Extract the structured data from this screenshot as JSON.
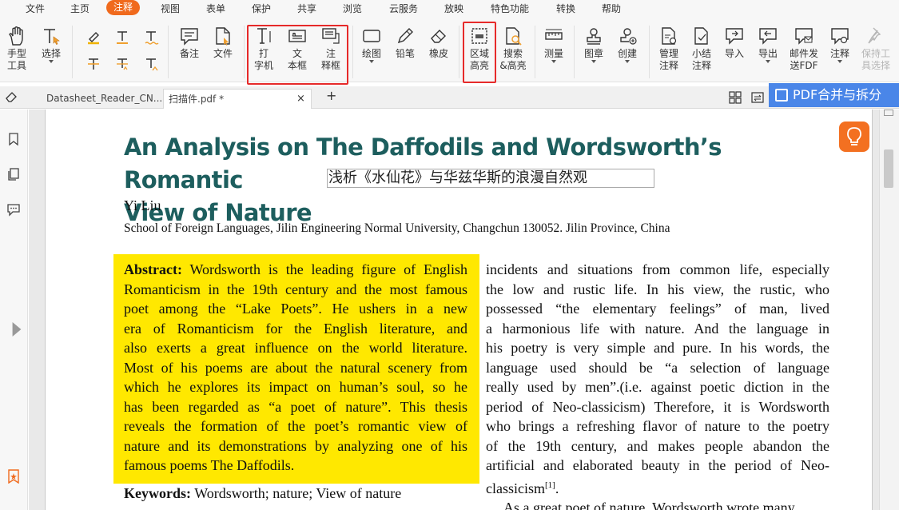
{
  "menu": {
    "items": [
      "文件",
      "主页",
      "注释",
      "视图",
      "表单",
      "保护",
      "共享",
      "浏览",
      "云服务",
      "放映",
      "特色功能",
      "转换",
      "帮助"
    ],
    "active": "注释"
  },
  "toolbar": {
    "hand": "手型\n工具",
    "select": "选择",
    "note": "备注",
    "file": "文件",
    "typewriter": "打\n字机",
    "textbox": "文\n本框",
    "callout": "注\n释框",
    "drawing": "绘图",
    "pencil": "铅笔",
    "eraser": "橡皮",
    "area_highlight": "区域\n高亮",
    "search_highlight": "搜索\n&高亮",
    "measure": "测量",
    "stamp": "图章",
    "create": "创建",
    "manage": "管理\n注释",
    "summary": "小结\n注释",
    "import": "导入",
    "export": "导出",
    "email": "邮件发\n送FDF",
    "annotate": "注释",
    "keep_tool": "保持工\n具选择"
  },
  "tabs": {
    "tab1": "Datasheet_Reader_CN....",
    "tab2": "扫描件.pdf *",
    "close": "×",
    "add": "+"
  },
  "promo": "PDF合并与拆分",
  "document": {
    "title_line1": "An Analysis on The Daffodils and Wordsworth’s Romantic",
    "title_line2": "View of Nature",
    "chinese_title": "浅析《水仙花》与华兹华斯的浪漫自然观",
    "author": "Yi Liu",
    "affiliation": "School of Foreign Languages, Jilin Engineering Normal University, Changchun 130052. Jilin Province, China",
    "abstract_label": "Abstract:",
    "abstract_lines": [
      "Wordsworth is the leading figure of English",
      "Romanticism in the 19th century and the most famous",
      "poet among the “Lake Poets”. He ushers in a new",
      "era of Romanticism for the English literature, and",
      "also exerts a great influence on the world literature.",
      "Most of his poems are about the natural scenery from",
      "which he explores its impact on human’s soul, so he",
      "has been regarded as “a poet of nature”. This thesis",
      "reveals the formation of the poet’s romantic view of",
      "nature and its demonstrations by analyzing one of his",
      "famous poems The Daffodils."
    ],
    "right_lines": [
      "incidents and situations from common life, especially",
      "the low and rustic life. In his view, the rustic, who",
      "possessed “the elementary feelings” of man, lived",
      "a harmonious life with nature. And the language in",
      "his poetry is very simple and pure. In his words, the",
      "language used should be “a selection of language",
      "really used by men”.(i.e. against poetic diction in the",
      "period of Neo-classicism) Therefore, it is Wordsworth",
      "who brings a refreshing flavor of nature to the poetry",
      "of the 19th century, and makes people abandon the",
      "artificial and elaborated beauty in the period of Neo-"
    ],
    "right_last": "classicism",
    "right_sup": "[1]",
    "right_last_tail": ".",
    "right_next": "As a great poet of nature, Wordsworth wrote many",
    "keywords_label": "Keywords:",
    "keywords": "Wordsworth; nature; View of nature"
  }
}
